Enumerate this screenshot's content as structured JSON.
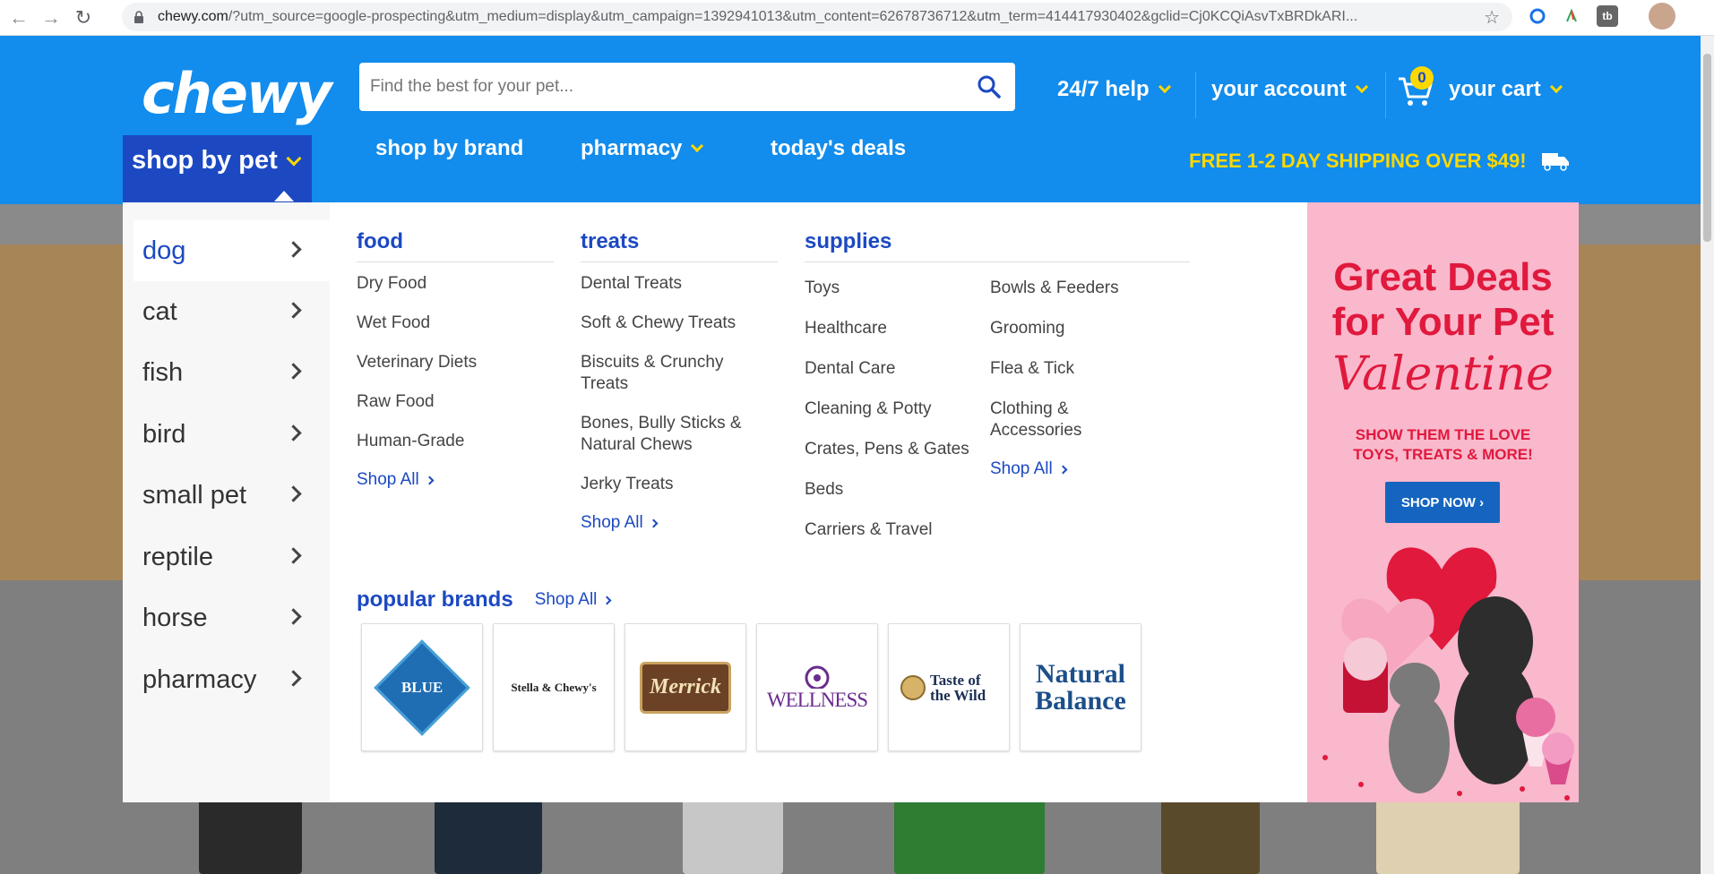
{
  "browser": {
    "url_host": "chewy.com",
    "url_rest": "/?utm_source=google-prospecting&utm_medium=display&utm_campaign=1392941013&utm_content=62678736712&utm_term=414417930402&gclid=Cj0KCQiAsvTxBRDkARI...",
    "ext_tb": "tb"
  },
  "header": {
    "logo": "chewy",
    "search_placeholder": "Find the best for your pet...",
    "help": "24/7 help",
    "account": "your account",
    "cart_count": "0",
    "cart": "your cart"
  },
  "subnav": {
    "shop_by_pet": "shop by pet",
    "shop_by_brand": "shop by brand",
    "pharmacy": "pharmacy",
    "todays_deals": "today's deals",
    "shipping": "FREE 1-2 DAY SHIPPING OVER $49!"
  },
  "pets": [
    "dog",
    "cat",
    "fish",
    "bird",
    "small pet",
    "reptile",
    "horse",
    "pharmacy"
  ],
  "food": {
    "title": "food",
    "links": [
      "Dry Food",
      "Wet Food",
      "Veterinary Diets",
      "Raw Food",
      "Human-Grade"
    ],
    "shop_all": "Shop All"
  },
  "treats": {
    "title": "treats",
    "links": [
      "Dental Treats",
      "Soft & Chewy Treats",
      "Biscuits & Crunchy Treats",
      "Bones, Bully Sticks & Natural Chews",
      "Jerky Treats"
    ],
    "shop_all": "Shop All"
  },
  "supplies": {
    "title": "supplies",
    "col1": [
      "Toys",
      "Healthcare",
      "Dental Care",
      "Cleaning & Potty",
      "Crates, Pens & Gates",
      "Beds",
      "Carriers & Travel"
    ],
    "col2": [
      "Bowls & Feeders",
      "Grooming",
      "Flea & Tick",
      "Clothing & Accessories"
    ],
    "shop_all": "Shop All"
  },
  "brands": {
    "title": "popular brands",
    "shop_all": "Shop All",
    "logos": [
      "BLUE",
      "Stella & Chewy's",
      "Merrick",
      "WELLNESS",
      "Taste of the Wild",
      "Natural Balance"
    ]
  },
  "promo": {
    "line1": "Great Deals",
    "line2": "for Your Pet",
    "line3": "Valentine",
    "sub1": "SHOW THEM THE LOVE",
    "sub2": "TOYS, TREATS & MORE!",
    "button": "SHOP NOW ›"
  },
  "colors": {
    "brand_blue": "#128ced",
    "dark_blue": "#1c49c2",
    "yellow": "#fcd800",
    "promo_pink": "#f9b8cc",
    "promo_red": "#e0193d"
  }
}
